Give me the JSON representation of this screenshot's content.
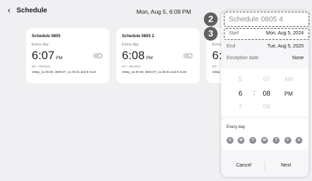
{
  "header": {
    "back_icon": "chevron-left",
    "back_glyph": "‹",
    "title": "Schedule",
    "datetime": "Mon, Aug 5, 6:09 PM"
  },
  "cards": [
    {
      "name": "Schedule 0805",
      "frequency": "Every day",
      "time": "6:07",
      "ampm": "PM",
      "range": "8/5 – 8/5/2025",
      "description": "1Way_11.00.00, 360CST_11.00.01 and 9 more",
      "toggle_on": false
    },
    {
      "name": "Schedule 0805 2",
      "frequency": "Every day",
      "time": "6:08",
      "ampm": "PM",
      "range": "8/7 – 8/5/2025",
      "description": "1Way_11.00.00, 360CST_11.00.01 and 9 more",
      "toggle_on": false
    },
    {
      "name": "",
      "frequency": "Every",
      "time": "6:",
      "ampm": "",
      "range": "8/9 –",
      "description": "1Way"
    }
  ],
  "editor": {
    "name_value": "Schedule 0805 4",
    "start_label": "Start",
    "start_value": "Mon, Aug 5, 2024",
    "end_label": "End",
    "end_value": "Tue, Aug 5, 2025",
    "exception_label": "Exception date",
    "exception_value": "None",
    "picker": {
      "hour_prev": "5",
      "hour": "6",
      "hour_next": "7",
      "separator": ":",
      "minute_prev": "07",
      "minute": "08",
      "minute_next": "09",
      "ampm_prev": "AM",
      "ampm": "PM"
    },
    "repeat_label": "Every day",
    "days": [
      "S",
      "M",
      "T",
      "W",
      "T",
      "F",
      "S"
    ],
    "cancel_label": "Cancel",
    "next_label": "Next"
  },
  "annotations": [
    "2",
    "3"
  ]
}
